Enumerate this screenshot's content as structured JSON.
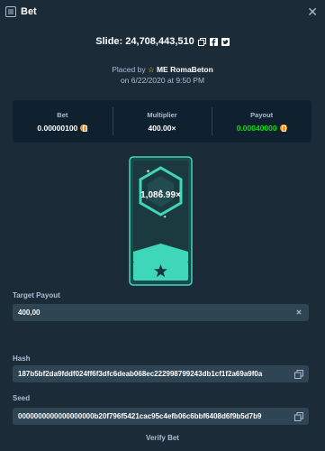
{
  "header": {
    "title": "Bet"
  },
  "slide": {
    "label": "Slide: 24,708,443,510"
  },
  "placed": {
    "prefix": "Placed by",
    "user": "ME RomaBeton",
    "date": "on 6/22/2020 at 9:50 PM"
  },
  "stats": {
    "bet_label": "Bet",
    "bet_value": "0.00000100",
    "multiplier_label": "Multiplier",
    "multiplier_value": "400.00×",
    "payout_label": "Payout",
    "payout_value": "0.00040000"
  },
  "card": {
    "multiplier": "1,086.99×"
  },
  "target_payout": {
    "label": "Target Payout",
    "value": "400,00"
  },
  "hash": {
    "label": "Hash",
    "value": "187b5bf2da9fddf024ff6f3dfc6deab068ec222998799243db1cf1f2a69a9f0a"
  },
  "seed": {
    "label": "Seed",
    "value": "0000000000000000000b20f796f5421cac95c4efb06c6bbf6408d6f9b5d7b9"
  },
  "verify": {
    "label": "Verify Bet"
  },
  "colors": {
    "background": "#1b2c38",
    "panel": "#0f212e",
    "accent_green": "#00e701",
    "card_teal": "#3ed7b9",
    "coin": "#f7931a"
  }
}
